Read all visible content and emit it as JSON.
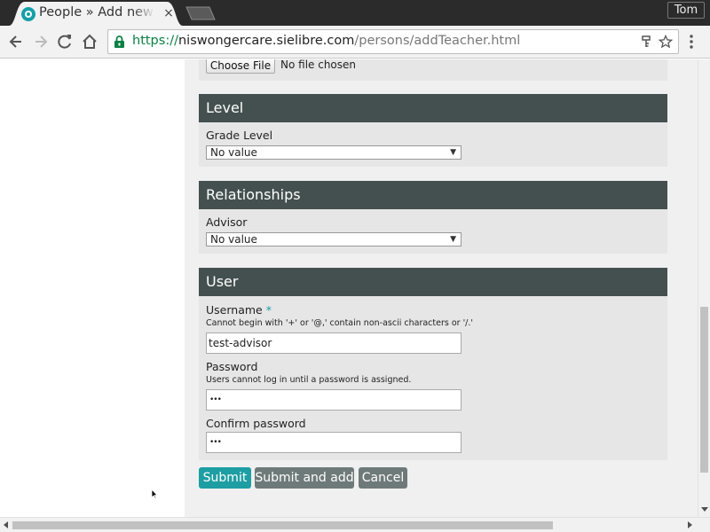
{
  "browser": {
    "tab": {
      "title": "People » Add new teacher",
      "close_glyph": "×"
    },
    "profile_name": "Tom",
    "url": {
      "scheme": "https://",
      "host": "niswongercare.sielibre.com",
      "path": "/persons/addTeacher.html"
    }
  },
  "page": {
    "file_upload": {
      "button_label": "Choose File",
      "status_text": "No file chosen"
    },
    "sections": {
      "level": {
        "title": "Level",
        "grade_level": {
          "label": "Grade Level",
          "selected": "No value"
        }
      },
      "relationships": {
        "title": "Relationships",
        "advisor": {
          "label": "Advisor",
          "selected": "No value"
        }
      },
      "user": {
        "title": "User",
        "username": {
          "label": "Username",
          "required_mark": "*",
          "help": "Cannot begin with '+' or '@,' contain non-ascii characters or '/.'",
          "value": "test-advisor"
        },
        "password": {
          "label": "Password",
          "help": "Users cannot log in until a password is assigned.",
          "value": "•••"
        },
        "confirm_password": {
          "label": "Confirm password",
          "value": "•••"
        }
      }
    },
    "actions": {
      "submit": "Submit",
      "submit_and_add": "Submit and add",
      "cancel": "Cancel"
    }
  },
  "colors": {
    "section_header": "#44504f",
    "primary_button": "#1d9ea3",
    "secondary_button": "#6e7a79",
    "url_scheme": "#0b8043"
  },
  "icons": [
    "back-icon",
    "forward-icon",
    "reload-icon",
    "home-icon",
    "lock-icon",
    "key-icon",
    "star-icon",
    "menu-icon",
    "select-arrow-icon"
  ]
}
